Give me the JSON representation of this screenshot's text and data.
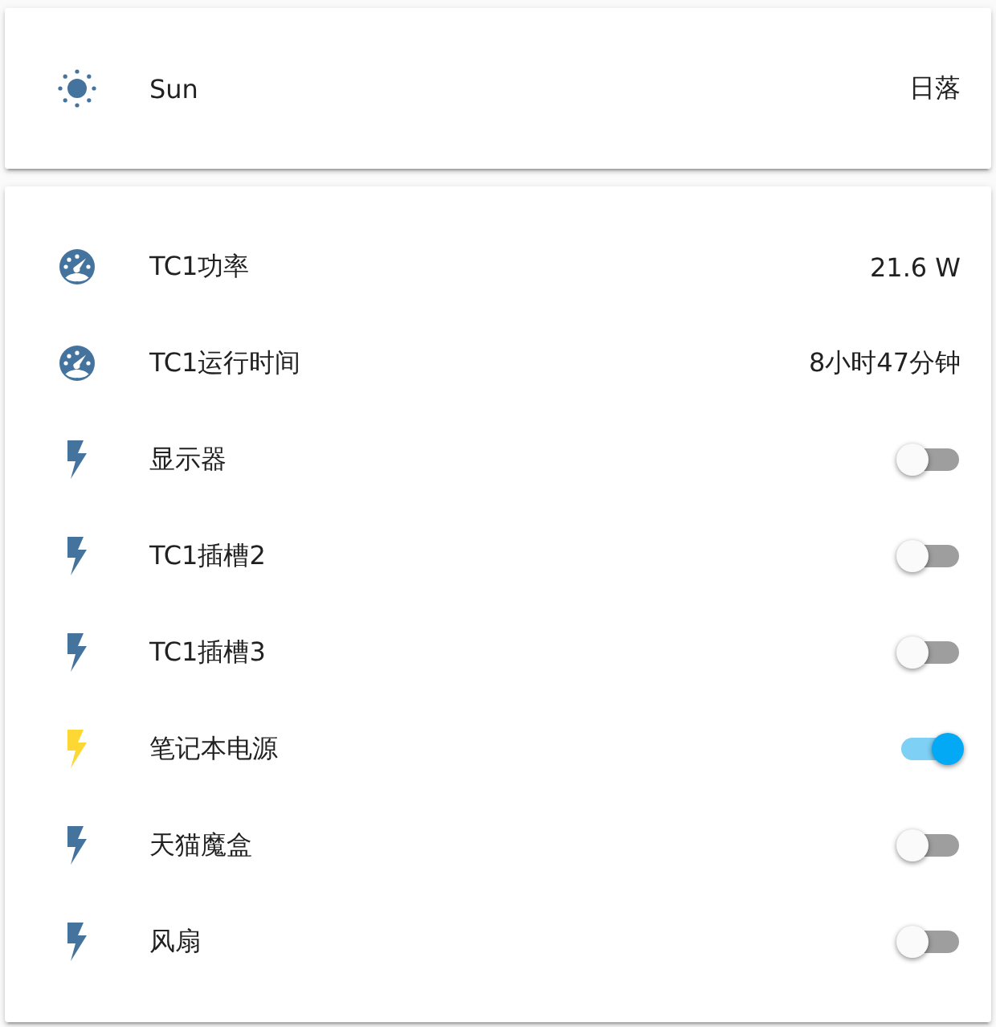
{
  "cards": [
    {
      "rows": [
        {
          "kind": "sun",
          "name": "Sun",
          "value": "日落"
        }
      ]
    },
    {
      "rows": [
        {
          "kind": "sensor",
          "name": "TC1功率",
          "value": "21.6 W"
        },
        {
          "kind": "sensor",
          "name": "TC1运行时间",
          "value": "8小时47分钟"
        },
        {
          "kind": "switch",
          "name": "显示器",
          "on": false
        },
        {
          "kind": "switch",
          "name": "TC1插槽2",
          "on": false
        },
        {
          "kind": "switch",
          "name": "TC1插槽3",
          "on": false
        },
        {
          "kind": "switch",
          "name": "笔记本电源",
          "on": true
        },
        {
          "kind": "switch",
          "name": "天猫魔盒",
          "on": false
        },
        {
          "kind": "switch",
          "name": "风扇",
          "on": false
        }
      ]
    }
  ]
}
